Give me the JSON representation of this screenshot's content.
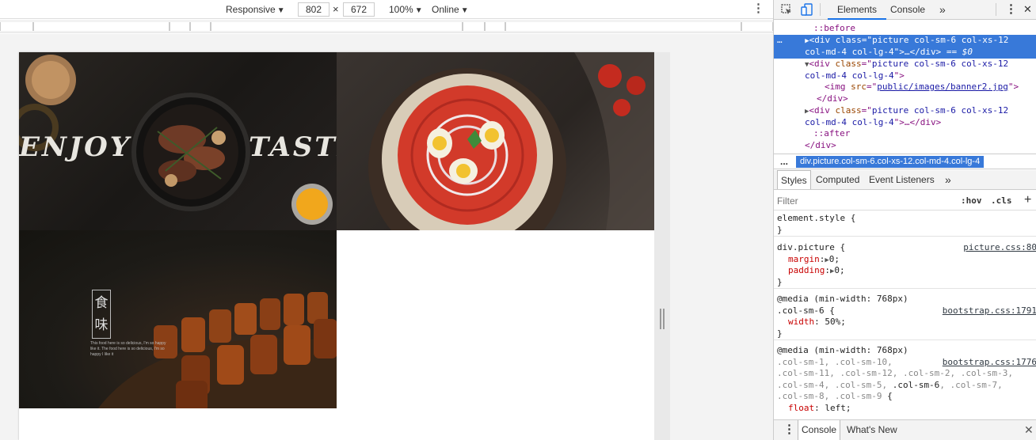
{
  "device_toolbar": {
    "mode": "Responsive",
    "width": "802",
    "times": "×",
    "height": "672",
    "zoom": "100%",
    "network": "Online",
    "caret": "▼",
    "more": "⋮"
  },
  "page": {
    "banner1": {
      "enjoy": "ENJOY",
      "taste": "TASTE"
    },
    "banner3": {
      "title_line1": "食",
      "title_line2": "味",
      "caption": "This food here is so delicious, I'm so happy like it. The food here is so delicious, I'm so happy I like it"
    }
  },
  "devtools": {
    "tabs": {
      "elements": "Elements",
      "console": "Console",
      "more": "»",
      "more_menu": "⋮",
      "close": "✕"
    },
    "tree": {
      "line0": "::before",
      "line1_dots": "…",
      "line1a": "<div ",
      "line1_attr": "class",
      "line1_eq": "=\"",
      "line1_val": "picture col-sm-6 col-xs-12",
      "line1b_val": "col-md-4 col-lg-4",
      "line1b_rest": "\">…</div>",
      "line1b_eq": " == $0",
      "line2a": "<div ",
      "line2_attr": "class",
      "line2_val": "picture col-sm-6 col-xs-12",
      "line2b_val": "col-md-4 col-lg-4",
      "line3a": "<img ",
      "line3_attr": "src",
      "line3_val": "public/images/banner2.jpg",
      "line3_rest": "\">",
      "line4": "</div>",
      "line5a": "<div ",
      "line5_attr": "class",
      "line5_val": "picture col-sm-6 col-xs-12",
      "line5b_val": "col-md-4 col-lg-4",
      "line5b_rest": "\">…</div>",
      "line6": "::after",
      "line7": "</div>"
    },
    "breadcrumb": {
      "dots": "...",
      "chip": "div.picture.col-sm-6.col-xs-12.col-md-4.col-lg-4"
    },
    "styles_tabs": {
      "styles": "Styles",
      "computed": "Computed",
      "listeners": "Event Listeners",
      "more": "»"
    },
    "filter": {
      "placeholder": "Filter",
      "hov": ":hov",
      "cls": ".cls",
      "plus": "+"
    },
    "rules": {
      "r1_sel": "element.style {",
      "close": "}",
      "r2_sel": "div.picture {",
      "r2_src": "picture.css:80",
      "r2_p1": "margin",
      "r2_v1": "0;",
      "r2_p2": "padding",
      "r2_v2": "0;",
      "r3_media": "@media (min-width: 768px)",
      "r3_sel": ".col-sm-6 {",
      "r3_src": "bootstrap.css:1791",
      "r3_p1": "width",
      "r3_v1": "50%;",
      "r4_media": "@media (min-width: 768px)",
      "r4_l1": ".col-sm-1, .col-sm-10,",
      "r4_src": "bootstrap.css:1776",
      "r4_l2": ".col-sm-11, .col-sm-12, .col-sm-2, .col-sm-3,",
      "r4_l3a": ".col-sm-4, .col-sm-5, ",
      "r4_l3b": ".col-sm-6",
      "r4_l3c": ", .col-sm-7,",
      "r4_l4a": ".col-sm-8, .col-sm-9",
      "r4_l4b": " {",
      "r4_p1": "float",
      "r4_v1": "left;"
    },
    "drawer": {
      "console": "Console",
      "whats_new": "What's New",
      "close": "✕",
      "menu": "⋮"
    }
  },
  "colors": {
    "selection": "#3879d9",
    "accent": "#1a73e8",
    "tag": "#881280",
    "attr": "#994500",
    "value": "#1a1aa6",
    "property": "#c80000"
  }
}
